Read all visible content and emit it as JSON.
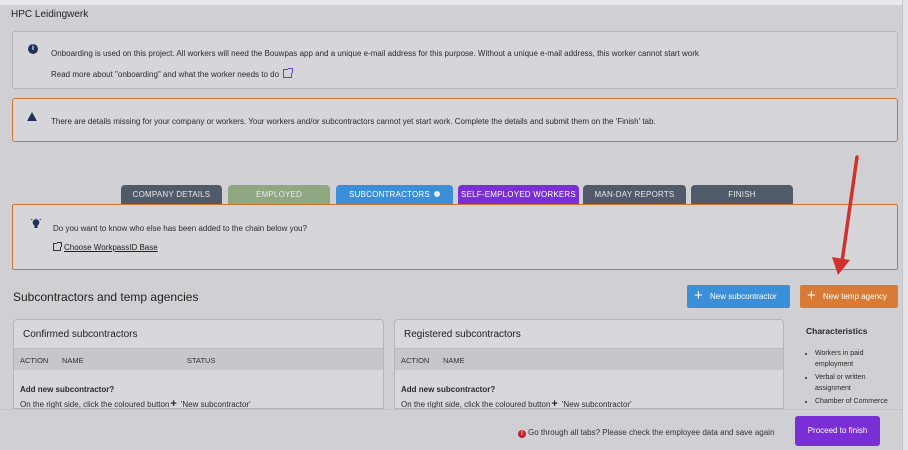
{
  "company_title": "HPC Leidingwerk",
  "info": {
    "line1": "Onboarding is used on this project. All workers will need the Bouwpas app and a unique e-mail address for this purpose. Without a unique e-mail address, this worker cannot start work",
    "line2": "Read more about \"onboarding\" and what the worker needs to do"
  },
  "warning": {
    "text": "There are details missing for your company or workers. Your workers and/or subcontractors cannot yet start work. Complete the details and submit them on the 'Finish' tab."
  },
  "tabs": [
    {
      "label": "COMPANY DETAILS",
      "color": "#515a68"
    },
    {
      "label": "EMPLOYED",
      "color": "#8fa882"
    },
    {
      "label": "SUBCONTRACTORS",
      "color": "#3a8fd8"
    },
    {
      "label": "SELF-EMPLOYED WORKERS",
      "color": "#7a2fd6"
    },
    {
      "label": "MAN-DAY REPORTS",
      "color": "#515a68"
    },
    {
      "label": "FINISH",
      "color": "#515a68"
    }
  ],
  "chain": {
    "question": "Do you want to know who else has been added to the chain below you?",
    "link": "Choose WorkpassID Base"
  },
  "section_title": "Subcontractors and temp agencies",
  "buttons": {
    "new_subcontractor": "New subcontractor",
    "new_temp_agency": "New temp agency",
    "proceed": "Proceed to finish"
  },
  "confirmed": {
    "title": "Confirmed subcontractors",
    "columns": [
      "ACTION",
      "NAME",
      "STATUS"
    ],
    "add_title": "Add new subcontractor?",
    "hint_before": "On the right side, click the coloured button",
    "hint_after": "'New subcontractor'"
  },
  "registered": {
    "title": "Registered subcontractors",
    "columns": [
      "ACTION",
      "NAME"
    ],
    "add_title": "Add new subcontractor?",
    "hint_before": "On the right side, click the coloured button",
    "hint_after": "'New subcontractor'"
  },
  "characteristics": {
    "title": "Characteristics",
    "items": [
      "Workers in paid employment",
      "Verbal or written assignment",
      "Chamber of Commerce"
    ]
  },
  "footer": {
    "error_text": "Go through all tabs? Please check the employee data and save again"
  },
  "colors": {
    "accent_orange": "#d97b35",
    "accent_blue": "#3a8fd8",
    "accent_purple": "#7a2fd6",
    "annotation_red": "#d0312d"
  }
}
